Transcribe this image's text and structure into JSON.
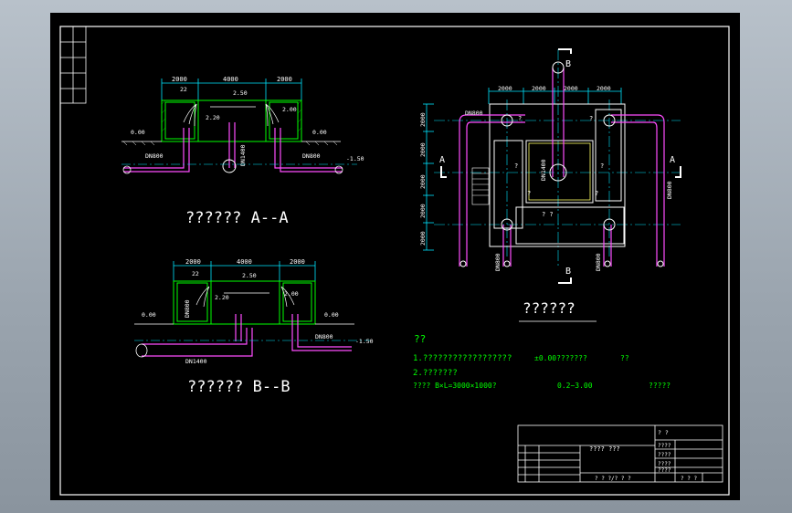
{
  "colors": {
    "frame": "#ffffff",
    "dim": "#00e5ff",
    "pipe": "#ff4dff",
    "wall": "#00ff00",
    "text": "#ffffff",
    "note": "#00ff00",
    "outline": "#ffff66"
  },
  "section_a": {
    "title": "?????? A--A",
    "dims": [
      "2000",
      "4000",
      "2000"
    ],
    "labels": {
      "top": "22",
      "water": "2.50",
      "left_level": "2.20",
      "right_level": "2.00",
      "ground_left": "0.00",
      "ground_right": "0.00",
      "pipe_left": "DN800",
      "pipe_mid": "DN1400",
      "pipe_right": "DN800",
      "bottom": "-1.50"
    }
  },
  "section_b": {
    "title": "?????? B--B",
    "dims": [
      "2000",
      "4000",
      "2000"
    ],
    "labels": {
      "top": "22",
      "water": "2.50",
      "left_level": "2.20",
      "right_level": "2.00",
      "ground_left": "0.00",
      "ground_right": "0.00",
      "pipe_left": "DN800",
      "pipe_bottom": "DN1400",
      "pipe_right": "DN800",
      "bottom": "-1.50"
    }
  },
  "plan": {
    "title": "??????",
    "section_markers": {
      "a": "A",
      "b": "B"
    },
    "dims_top": [
      "2000",
      "2000",
      "2000",
      "2000"
    ],
    "dims_left": [
      "2000",
      "2000",
      "2000",
      "2000",
      "2000"
    ],
    "pipe_labels": {
      "center": "DN1400",
      "right": "DN800",
      "bottom_left": "DN800",
      "bottom_right": "DN800",
      "top_left": "DN800"
    },
    "marks": [
      "?",
      "?",
      "?",
      "?",
      "?",
      "?",
      "? ?"
    ]
  },
  "notes": {
    "heading": "??",
    "line1": "1.??????????????????",
    "line1_b": "±0.00???????",
    "line1_c": "??",
    "line2": "2.???????",
    "line3": "???? B×L=3000×1000?",
    "line3_b": "0.2~3.00",
    "line3_c": "?????"
  },
  "title_block": {
    "name": "???? ???",
    "right_top": "? ?",
    "right_rows": [
      "????",
      "????",
      "????",
      "????"
    ],
    "bottom": "? ? ?/? ? ?",
    "bottom_right": "? ? ?"
  }
}
